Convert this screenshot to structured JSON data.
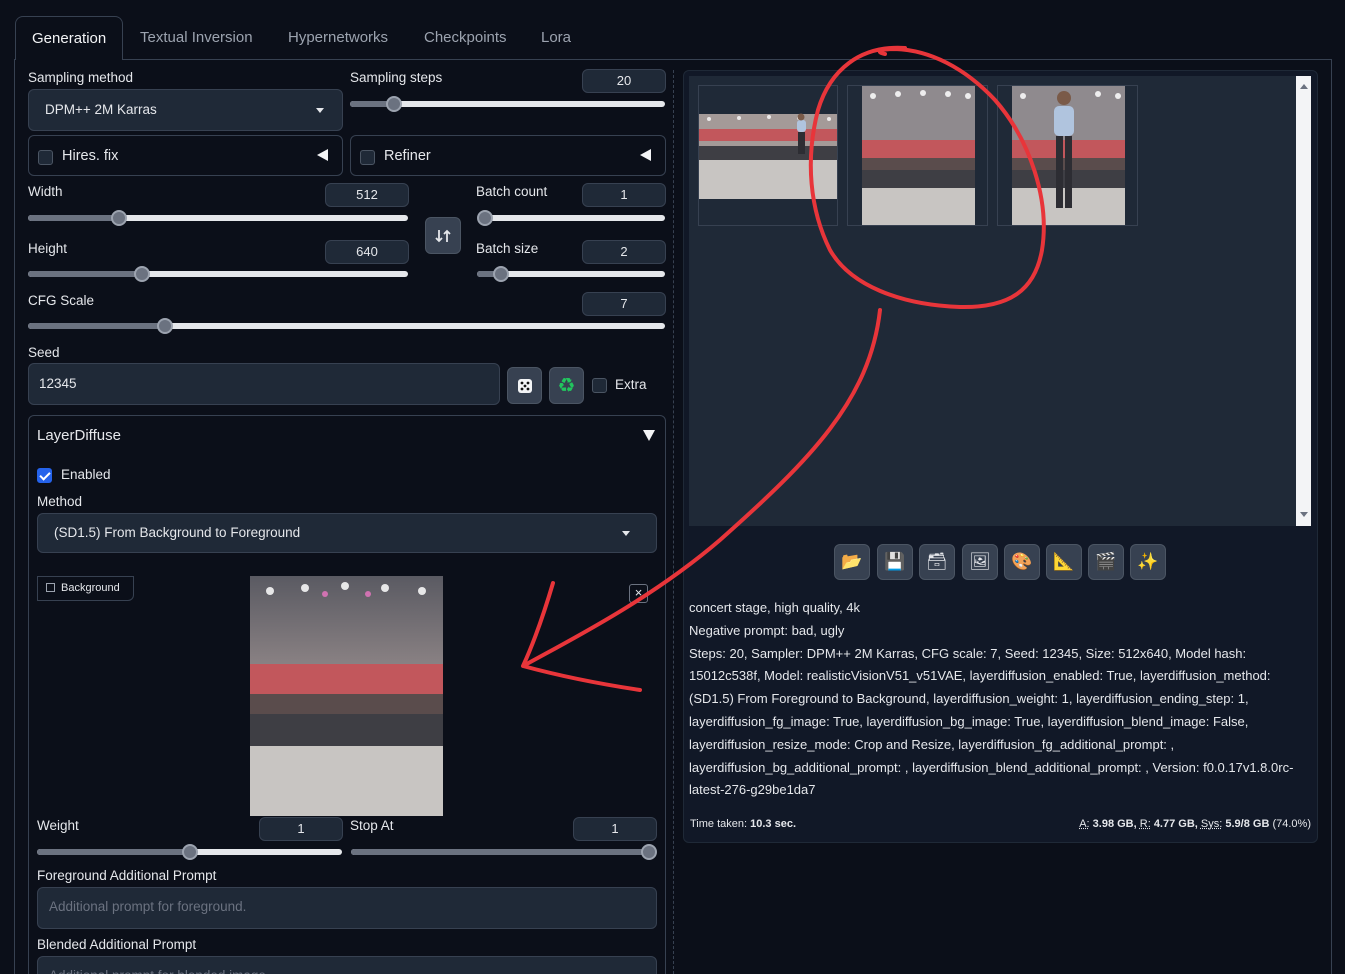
{
  "tabs": [
    "Generation",
    "Textual Inversion",
    "Hypernetworks",
    "Checkpoints",
    "Lora"
  ],
  "left": {
    "sampling_method": {
      "label": "Sampling method",
      "value": "DPM++ 2M Karras"
    },
    "sampling_steps": {
      "label": "Sampling steps",
      "value": "20",
      "fraction": 0.14
    },
    "hires_fix": {
      "label": "Hires. fix",
      "checked": false
    },
    "refiner": {
      "label": "Refiner",
      "checked": false
    },
    "width": {
      "label": "Width",
      "value": "512",
      "fraction": 0.24
    },
    "height": {
      "label": "Height",
      "value": "640",
      "fraction": 0.3
    },
    "batch_count": {
      "label": "Batch count",
      "value": "1",
      "fraction": 0.0
    },
    "batch_size": {
      "label": "Batch size",
      "value": "2",
      "fraction": 0.13
    },
    "cfg_scale": {
      "label": "CFG Scale",
      "value": "7",
      "fraction": 0.215
    },
    "seed": {
      "label": "Seed",
      "value": "12345",
      "extra_label": "Extra"
    },
    "layerdiffuse": {
      "title": "LayerDiffuse",
      "enabled_label": "Enabled",
      "method_label": "Method",
      "method_value": "(SD1.5) From Background to Foreground",
      "background_label": "Background",
      "weight": {
        "label": "Weight",
        "value": "1",
        "fraction": 0.5
      },
      "stop_at": {
        "label": "Stop At",
        "value": "1",
        "fraction": 1.0
      },
      "fg_prompt_label": "Foreground Additional Prompt",
      "fg_prompt_placeholder": "Additional prompt for foreground.",
      "blend_prompt_label": "Blended Additional Prompt",
      "blend_prompt_placeholder": "Additional prompt for blended image."
    }
  },
  "right": {
    "toolbar_icons": [
      "folder-icon",
      "save-icon",
      "zip-icon",
      "image-icon",
      "palette-icon",
      "ruler-icon",
      "clapper-icon",
      "sparkle-icon"
    ],
    "info_lines": [
      "concert stage, high quality, 4k",
      "Negative prompt: bad, ugly",
      "Steps: 20, Sampler: DPM++ 2M Karras, CFG scale: 7, Seed: 12345, Size: 512x640, Model hash: 15012c538f, Model: realisticVisionV51_v51VAE, layerdiffusion_enabled: True, layerdiffusion_method: (SD1.5) From Foreground to Background, layerdiffusion_weight: 1, layerdiffusion_ending_step: 1, layerdiffusion_fg_image: True, layerdiffusion_bg_image: True, layerdiffusion_blend_image: False, layerdiffusion_resize_mode: Crop and Resize, layerdiffusion_fg_additional_prompt: , layerdiffusion_bg_additional_prompt: , layerdiffusion_blend_additional_prompt: , Version: f0.0.17v1.8.0rc-latest-276-g29be1da7"
    ],
    "time_taken_label": "Time taken:",
    "time_taken_value": "10.3 sec.",
    "vram": {
      "a_label": "A:",
      "a_value": "3.98 GB,",
      "r_label": "R:",
      "r_value": "4.77 GB,",
      "sys_label": "Sys:",
      "sys_value": "5.9/8 GB",
      "pct": "(74.0%)"
    }
  },
  "colors": {
    "bg": "#0b0f19",
    "panel": "#1f2937",
    "border": "#374151",
    "annotation": "#e8353a"
  }
}
